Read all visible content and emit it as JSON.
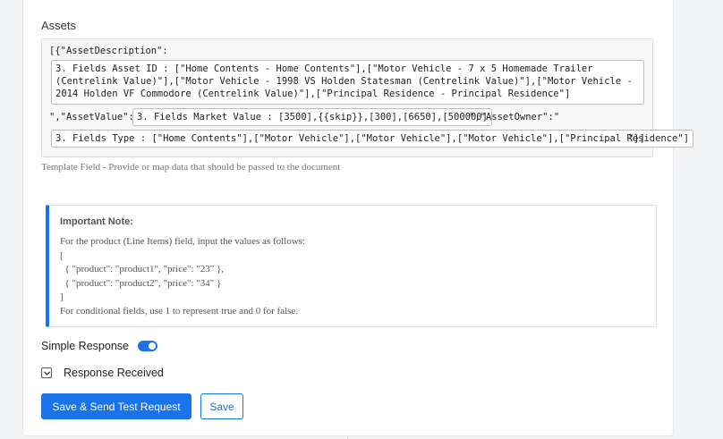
{
  "assets": {
    "label": "Assets",
    "prefix_description": "[{\"AssetDescription\":",
    "description_value": "3. Fields Asset ID : [\"Home Contents - Home Contents\"],[\"Motor Vehicle - 7 x 5 Homemade Trailer (Centrelink Value)\"],[\"Motor Vehicle - 1998 VS Holden Statesman (Centrelink Value)\"],[\"Motor Vehicle - 2014 Holden VF Commodore (Centrelink Value)\"],[\"Principal Residence - Principal Residence\"]",
    "prefix_value": "\",\"AssetValue\":\"",
    "value_value": "3. Fields Market Value : [3500],{{skip}},[300],[6650],[500000]",
    "prefix_owner": "\",\"AssetOwner\":\"",
    "type_value": "3. Fields Type : [\"Home Contents\"],[\"Motor Vehicle\"],[\"Motor Vehicle\"],[\"Motor Vehicle\"],[\"Principal Residence\"]",
    "suffix": "\"}]",
    "hint": "Template Field - Provide or map data that should be passed to the document"
  },
  "note": {
    "title": "Important Note:",
    "lines": [
      "For the product (Line Items) field, input the values as follows:",
      "[",
      "  { \"product\": \"product1\", \"price\": \"23\" },",
      "  { \"product\": \"product2\", \"price\": \"34\" }",
      "]",
      "For conditional fields, use 1 to represent true and 0 for false."
    ]
  },
  "simple_response": {
    "label": "Simple Response",
    "enabled": true
  },
  "response_received": {
    "label": "Response Received"
  },
  "buttons": {
    "save_send": "Save & Send Test Request",
    "save": "Save"
  },
  "colors": {
    "accent": "#1a73e8"
  }
}
